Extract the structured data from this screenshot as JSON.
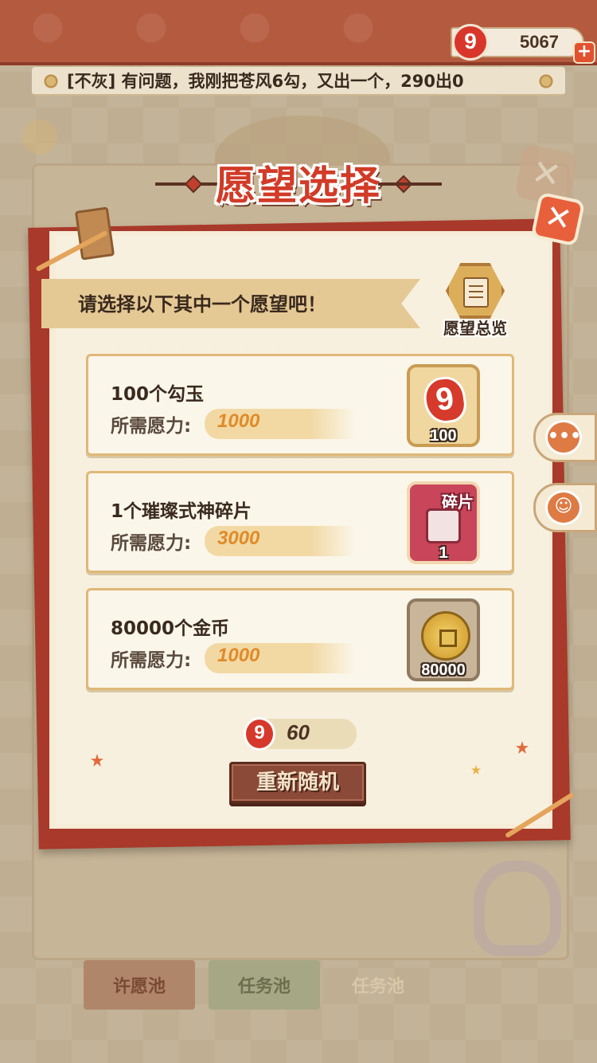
{
  "currency": {
    "icon": "magatama-icon",
    "value": "5067",
    "plus_label": "+"
  },
  "chat": {
    "message": "[不灰] 有问题，我刚把苍风6勾，又出一个，290出0"
  },
  "dialog": {
    "title": "愿望选择",
    "prompt": "请选择以下其中一个愿望吧！",
    "overview_label": "愿望总览",
    "close_label": "✕"
  },
  "wishes": [
    {
      "name": "100个勾玉",
      "cost_label": "所需愿力:",
      "cost_value": "1000",
      "icon": "magatama-icon",
      "icon_glyph": "9",
      "count": "100"
    },
    {
      "name": "1个璀璨式神碎片",
      "cost_label": "所需愿力:",
      "cost_value": "3000",
      "icon": "shikigami-shard-icon",
      "icon_glyph": "碎片",
      "count": "1"
    },
    {
      "name": "80000个金币",
      "cost_label": "所需愿力:",
      "cost_value": "1000",
      "icon": "gold-coin-icon",
      "icon_glyph": "",
      "count": "80000"
    }
  ],
  "reroll": {
    "cost_icon": "magatama-icon",
    "cost_icon_glyph": "9",
    "cost": "60",
    "button_label": "重新随机"
  },
  "side_buttons": [
    {
      "icon": "chat-bubble-icon",
      "glyph": "•••"
    },
    {
      "icon": "character-icon",
      "glyph": "☺"
    }
  ],
  "background_tabs": [
    {
      "label": "许愿池"
    },
    {
      "label": "任务池"
    },
    {
      "label": "任务池"
    }
  ],
  "colors": {
    "accent_red": "#d13b27",
    "panel_red": "#a9392a",
    "cost_orange": "#e08b2a",
    "button_brown": "#8a4a37"
  }
}
